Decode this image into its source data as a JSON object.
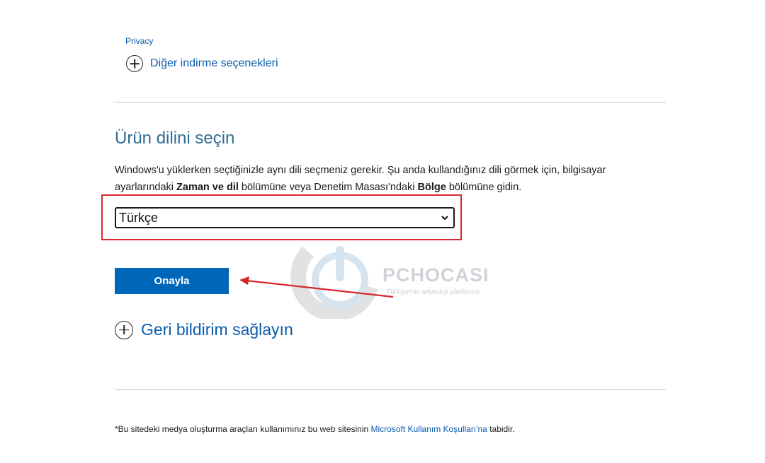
{
  "links": {
    "privacy": "Privacy"
  },
  "download_options": {
    "label": "Diğer indirme seçenekleri",
    "icon": "plus-circle-icon"
  },
  "language_section": {
    "title": "Ürün dilini seçin",
    "description": {
      "part1": "Windows'u yüklerken seçtiğinizle aynı dili seçmeniz gerekir. Şu anda kullandığınız dili görmek için, bilgisayar ayarlarındaki ",
      "bold1": "Zaman ve dil",
      "part2": " bölümüne veya Denetim Masası'ndaki ",
      "bold2": "Bölge",
      "part3": " bölümüne gidin."
    },
    "selected_language": "Türkçe",
    "confirm_label": "Onayla"
  },
  "feedback": {
    "label": "Geri bildirim sağlayın",
    "icon": "plus-circle-icon"
  },
  "watermark": {
    "brand": "PCHOCASI",
    "tagline": "Türkiye'nin teknoloji platformu"
  },
  "footer": {
    "prefix": "*Bu sitedeki medya oluşturma araçları kullanımınız bu web sitesinin ",
    "link": "Microsoft Kullanım Koşulları'na",
    "suffix": " tabidir."
  },
  "colors": {
    "accent": "#0067b8",
    "link": "#0b5cad",
    "title": "#2f6b93",
    "highlight": "#d8262e"
  }
}
